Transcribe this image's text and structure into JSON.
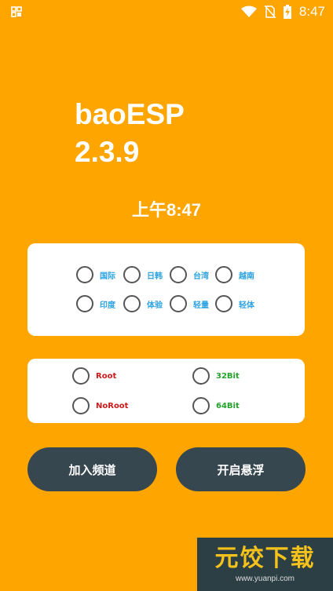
{
  "status_bar": {
    "time": "8:47",
    "icons": [
      "gallery-icon",
      "wifi-icon",
      "no-sim-icon",
      "battery-charging-icon"
    ]
  },
  "app": {
    "name": "baoESP",
    "version": "2.3.9"
  },
  "clock": {
    "text": "上午8:47"
  },
  "regions": [
    {
      "label": "国际"
    },
    {
      "label": "日韩"
    },
    {
      "label": "台湾"
    },
    {
      "label": "越南"
    },
    {
      "label": "印度"
    },
    {
      "label": "体验"
    },
    {
      "label": "轻量"
    },
    {
      "label": "轻体"
    }
  ],
  "modes": {
    "root": "Root",
    "bit32": "32Bit",
    "noroot": "NoRoot",
    "bit64": "64Bit"
  },
  "buttons": {
    "join_channel": "加入频道",
    "open_float": "开启悬浮"
  },
  "watermark": {
    "main": "元饺下载",
    "url": "www.yuanpi.com"
  },
  "colors": {
    "background": "#FFA500",
    "button": "#37474F",
    "region_label": "#2EA3E0",
    "root_label": "#CC1A1A",
    "bit_label": "#22A32A"
  }
}
